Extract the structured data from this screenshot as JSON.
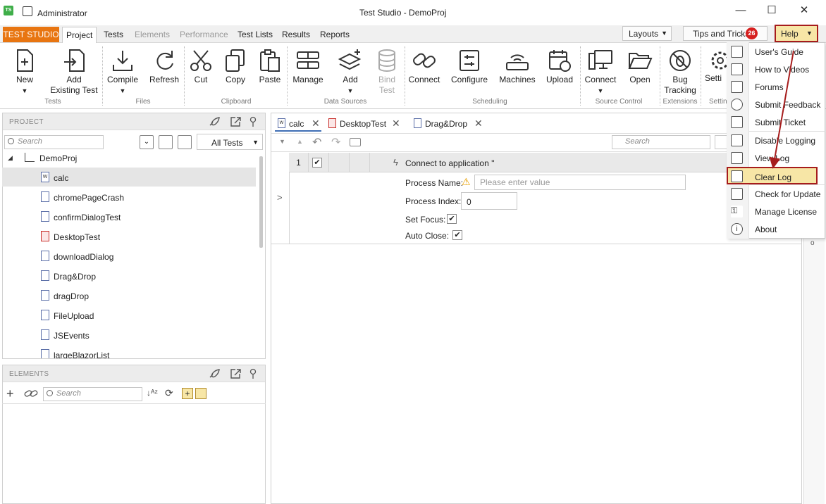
{
  "titlebar": {
    "user": "Administrator",
    "title": "Test Studio - DemoProj",
    "logo": "TS"
  },
  "ribbon_tabs": {
    "brand": "TEST STUDIO",
    "project": "Project",
    "tests": "Tests",
    "elements": "Elements",
    "performance": "Performance",
    "test_lists": "Test Lists",
    "results": "Results",
    "reports": "Reports"
  },
  "top_right": {
    "layouts": "Layouts",
    "tips": "Tips and Tricks",
    "tips_count": "26",
    "help": "Help"
  },
  "ribbon": {
    "new": "New",
    "add_existing_1": "Add",
    "add_existing_2": "Existing Test",
    "compile": "Compile",
    "refresh": "Refresh",
    "cut": "Cut",
    "copy": "Copy",
    "paste": "Paste",
    "manage": "Manage",
    "add": "Add",
    "bind_1": "Bind",
    "bind_2": "Test",
    "connect": "Connect",
    "configure": "Configure",
    "machines": "Machines",
    "upload": "Upload",
    "sc_connect": "Connect",
    "open": "Open",
    "bug_1": "Bug",
    "bug_2": "Tracking",
    "settings": "Setti",
    "groups": {
      "tests": "Tests",
      "files": "Files",
      "clipboard": "Clipboard",
      "data_sources": "Data Sources",
      "scheduling": "Scheduling",
      "source_control": "Source Control",
      "extensions": "Extensions",
      "settings": "Settin"
    }
  },
  "project_panel": {
    "header": "PROJECT",
    "search_placeholder": "Search",
    "filter": "All Tests",
    "root": "DemoProj",
    "items": [
      {
        "name": "calc",
        "icon": "W"
      },
      {
        "name": "chromePageCrash",
        "icon": ""
      },
      {
        "name": "confirmDialogTest",
        "icon": ""
      },
      {
        "name": "DesktopTest",
        "icon": ""
      },
      {
        "name": "downloadDialog",
        "icon": ""
      },
      {
        "name": "Drag&Drop",
        "icon": ""
      },
      {
        "name": "dragDrop",
        "icon": ""
      },
      {
        "name": "FileUpload",
        "icon": ""
      },
      {
        "name": "JSEvents",
        "icon": ""
      },
      {
        "name": "largeBlazorList",
        "icon": ""
      }
    ]
  },
  "elements_panel": {
    "header": "ELEMENTS",
    "search_placeholder": "Search"
  },
  "doc_tabs": [
    {
      "label": "calc"
    },
    {
      "label": "DesktopTest"
    },
    {
      "label": "Drag&Drop"
    }
  ],
  "editor": {
    "search_placeholder": "Search",
    "step_number": "1",
    "step_title": "Connect to application ''",
    "process_name_label": "Process Name:",
    "process_name_placeholder": "Please enter value",
    "process_index_label": "Process Index:",
    "process_index_value": "0",
    "set_focus_label": "Set Focus:",
    "auto_close_label": "Auto Close:",
    "expander": ">"
  },
  "help_menu": {
    "items": [
      "User's Guide",
      "How to Videos",
      "Forums",
      "Submit Feedback",
      "Submit Ticket",
      "Disable Logging",
      "View Log",
      "Clear Log",
      "Check for Update",
      "Manage License",
      "About"
    ]
  },
  "colors": {
    "brand": "#e87511",
    "highlight_border": "#a61c1c",
    "highlight_fill": "#f7e6a6",
    "badge": "#d6201f"
  }
}
